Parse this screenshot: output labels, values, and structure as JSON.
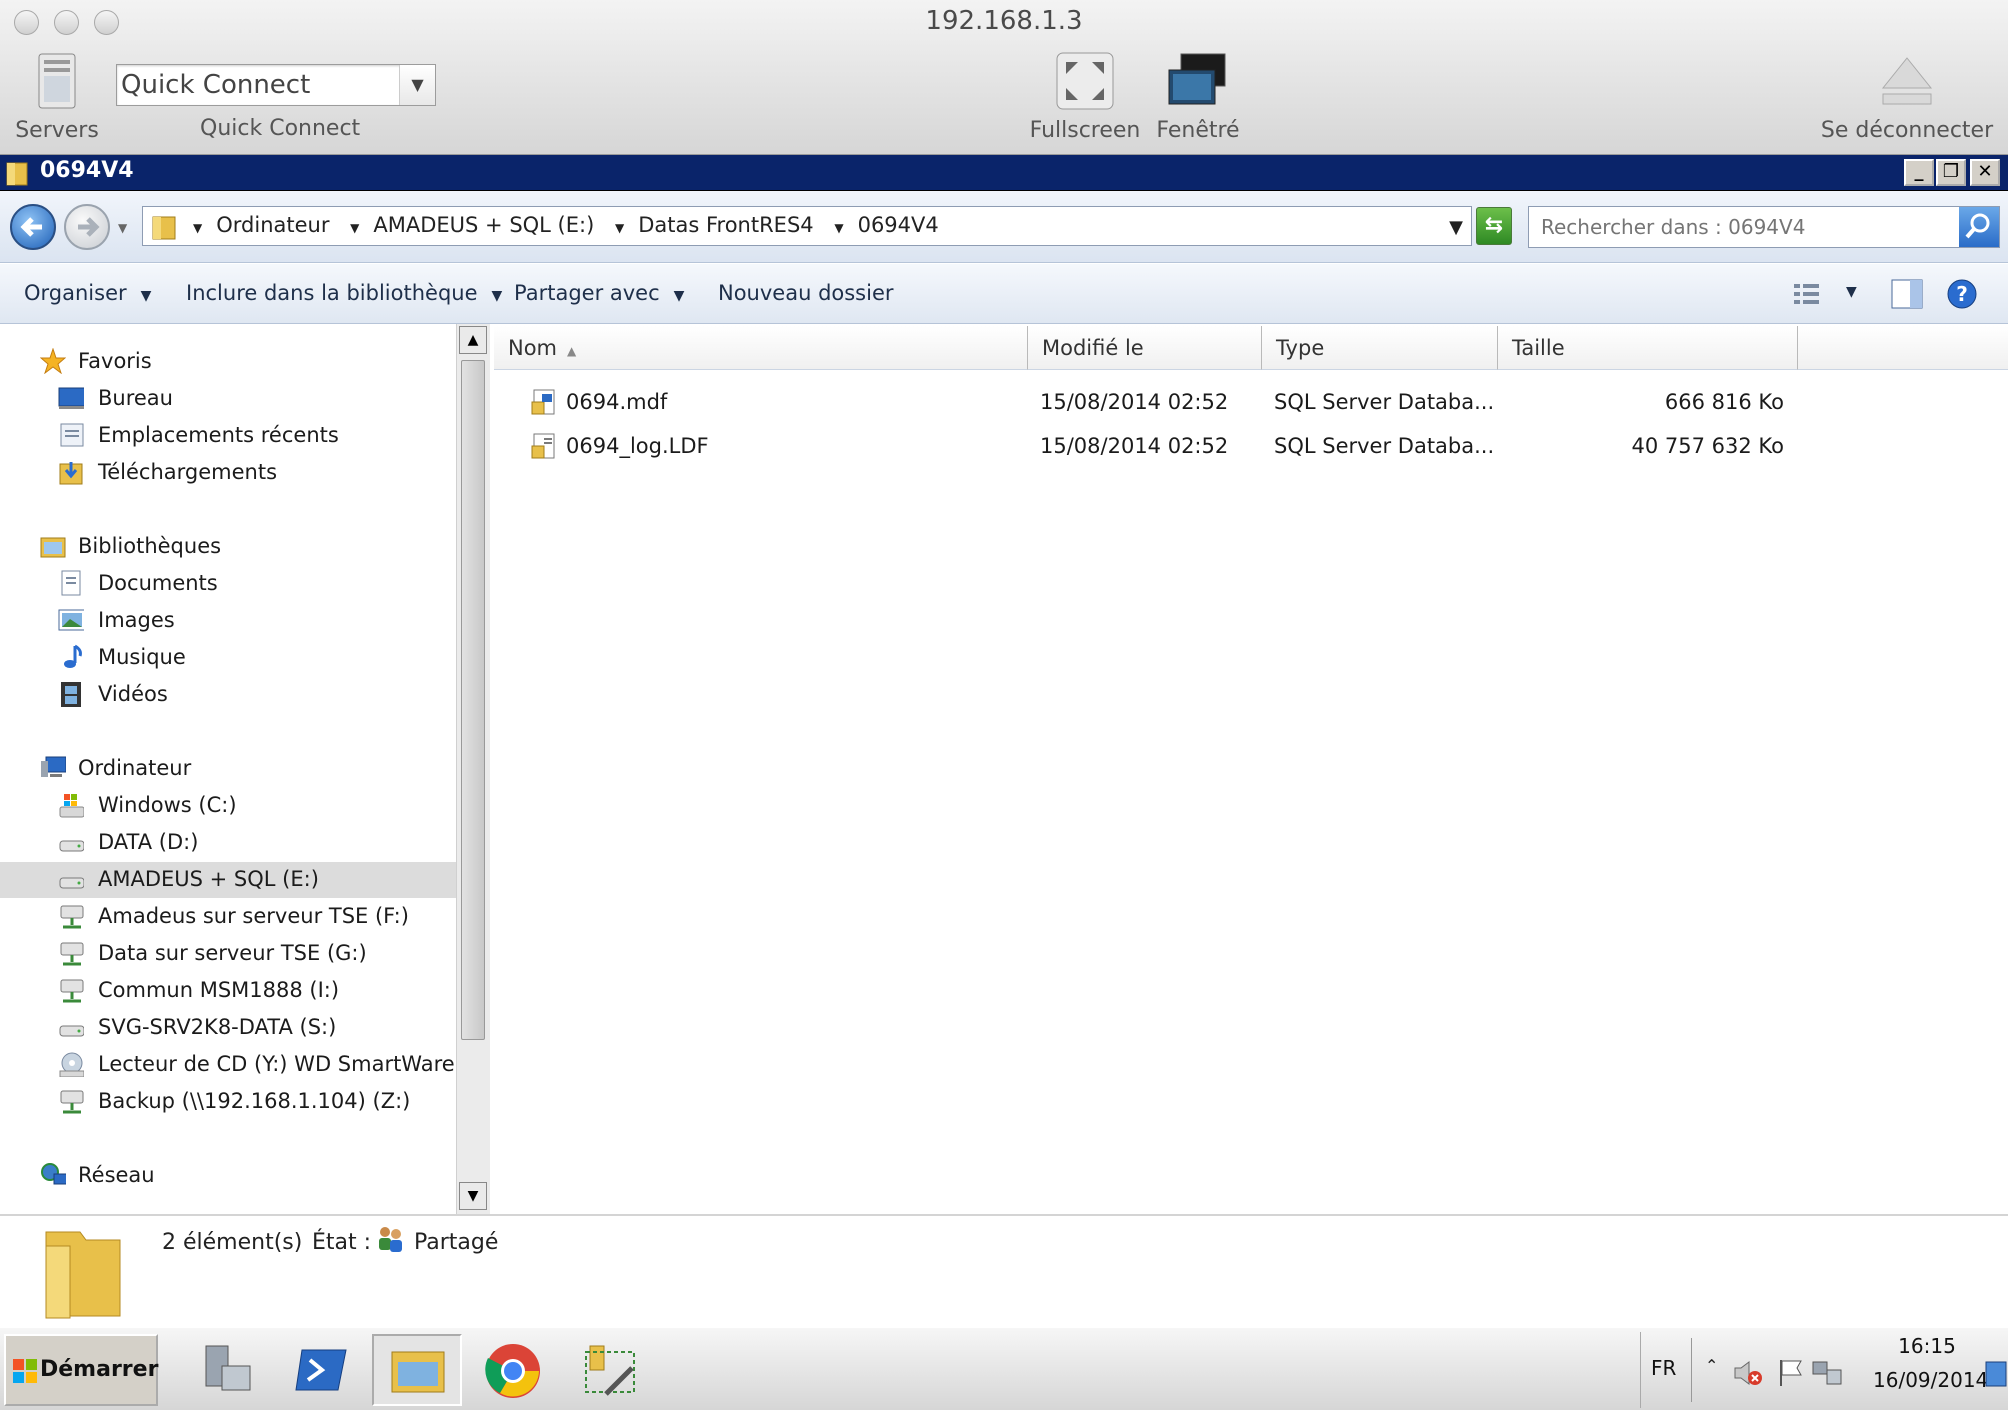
{
  "mac": {
    "title": "192.168.1.3",
    "servers_label": "Servers",
    "quick_connect_value": "Quick Connect",
    "quick_connect_label": "Quick Connect",
    "fullscreen_label": "Fullscreen",
    "window_label": "Fenêtré",
    "disconnect_label": "Se déconnecter"
  },
  "window": {
    "title": "0694V4",
    "breadcrumb": [
      "Ordinateur",
      "AMADEUS + SQL (E:)",
      "Datas FrontRES4",
      "0694V4"
    ],
    "search_placeholder": "Rechercher dans : 0694V4"
  },
  "toolbar": {
    "organise": "Organiser",
    "include": "Inclure dans la bibliothèque",
    "share": "Partager avec",
    "new_folder": "Nouveau dossier"
  },
  "nav": {
    "favorites": {
      "label": "Favoris",
      "items": [
        "Bureau",
        "Emplacements récents",
        "Téléchargements"
      ]
    },
    "libraries": {
      "label": "Bibliothèques",
      "items": [
        "Documents",
        "Images",
        "Musique",
        "Vidéos"
      ]
    },
    "computer": {
      "label": "Ordinateur",
      "items": [
        "Windows (C:)",
        "DATA (D:)",
        "AMADEUS + SQL (E:)",
        "Amadeus sur serveur TSE (F:)",
        "Data sur serveur TSE (G:)",
        "Commun MSM1888 (I:)",
        "SVG-SRV2K8-DATA (S:)",
        "Lecteur de CD (Y:) WD SmartWare",
        "Backup (\\\\192.168.1.104) (Z:)"
      ]
    },
    "network": {
      "label": "Réseau"
    }
  },
  "columns": [
    "Nom",
    "Modifié le",
    "Type",
    "Taille"
  ],
  "files": [
    {
      "name": "0694.mdf",
      "modified": "15/08/2014 02:52",
      "type": "SQL Server Databa...",
      "size": "666 816 Ko"
    },
    {
      "name": "0694_log.LDF",
      "modified": "15/08/2014 02:52",
      "type": "SQL Server Databa...",
      "size": "40 757 632 Ko"
    }
  ],
  "details": {
    "count": "2 élément(s)",
    "state_label": "État :",
    "state_value": "Partagé"
  },
  "taskbar": {
    "start": "Démarrer",
    "lang": "FR",
    "time": "16:15",
    "date": "16/09/2014"
  }
}
